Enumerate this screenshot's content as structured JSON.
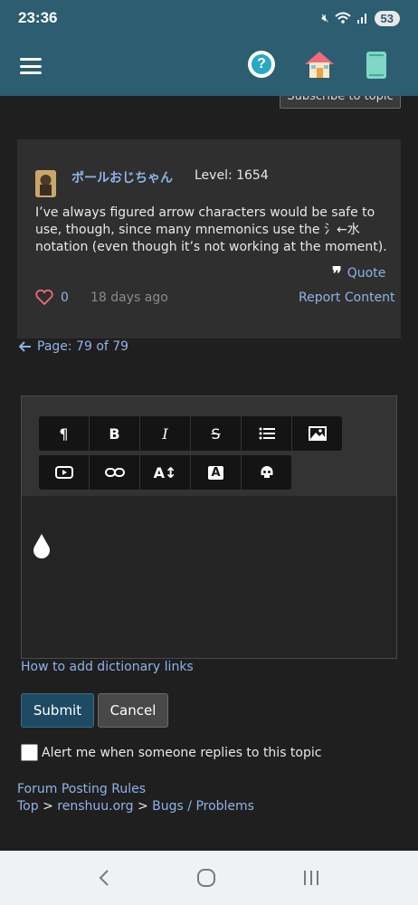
{
  "status": {
    "time": "23:36",
    "battery": "53"
  },
  "appbar": {
    "menu_icon": "hamburger-icon",
    "help_icon": "question-circle-icon",
    "home_icon": "house-icon",
    "book_icon": "book-icon",
    "help_label": "?"
  },
  "top": {
    "subscribe_label": "Subscribe to topic"
  },
  "post": {
    "username": "ポールおじちゃん",
    "level": "Level: 1654",
    "body": "I’ve always figured arrow characters would be safe to use, though, since many mnemonics use the 氵←水 notation (even though it’s not working at the moment).",
    "quote_label": "Quote",
    "likes": "0",
    "time_ago": "18 days ago",
    "report_label": "Report Content"
  },
  "pager": {
    "label": "Page: 79 of 79"
  },
  "editor": {
    "toolbar_row1": [
      "¶",
      "B",
      "I",
      "S",
      "list",
      "image"
    ],
    "toolbar_row2": [
      "video",
      "link",
      "font-size",
      "font-color",
      "skull"
    ]
  },
  "form": {
    "dict_link": "How to add dictionary links",
    "submit_label": "Submit",
    "cancel_label": "Cancel",
    "alert_label": "Alert me when someone replies to this topic"
  },
  "footer": {
    "rules_link": "Forum Posting Rules",
    "crumb_top": "Top",
    "crumb_site": "renshuu.org",
    "crumb_section": "Bugs / Problems",
    "sep": ">"
  },
  "colors": {
    "accent": "#2c5d70",
    "link": "#8fb3e8",
    "background": "#1f1f1f"
  }
}
